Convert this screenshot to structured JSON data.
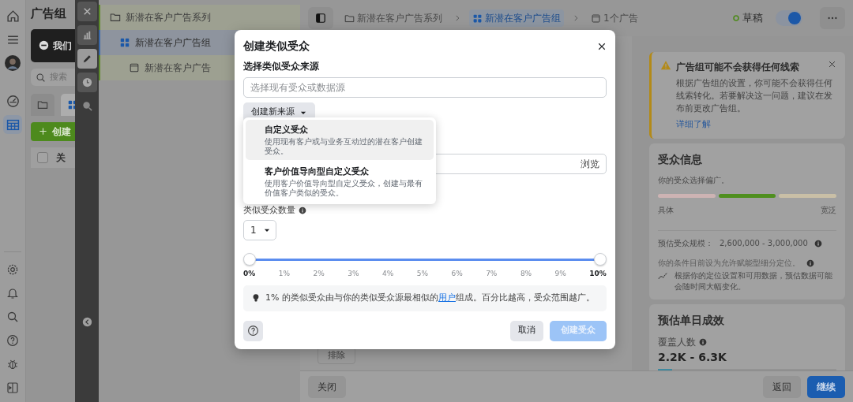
{
  "nav_rail": {
    "items": [
      {
        "kind": "home",
        "selected": false
      },
      {
        "kind": "menu",
        "selected": false
      },
      {
        "kind": "avatar",
        "selected": false
      },
      {
        "kind": "gauge",
        "selected": false
      },
      {
        "kind": "table",
        "selected": true
      }
    ],
    "bottom_items": [
      {
        "kind": "settings"
      },
      {
        "kind": "bell"
      },
      {
        "kind": "search"
      },
      {
        "kind": "help"
      },
      {
        "kind": "bug"
      },
      {
        "kind": "panel"
      }
    ]
  },
  "ad_panel": {
    "title": "广告组",
    "notice": "我们",
    "search": {
      "placeholder": "搜索"
    },
    "tabs": [
      {
        "kind": "campaign",
        "selected": false
      },
      {
        "kind": "adset",
        "selected": true
      }
    ],
    "create_button": "创建",
    "header": {
      "checked": false,
      "column_1": "关"
    }
  },
  "tool_strip": {
    "items": [
      {
        "kind": "close",
        "selected": false
      },
      {
        "kind": "chart",
        "selected": false
      },
      {
        "kind": "edit",
        "selected": true
      },
      {
        "kind": "history",
        "selected": false
      },
      {
        "kind": "inspect",
        "selected": false
      }
    ]
  },
  "tree": [
    {
      "kind": "campaign",
      "label": "新潜在客户广告系列",
      "selected": false,
      "children": [
        {
          "kind": "adset",
          "label": "新潜在客户广告组",
          "selected": true,
          "children": [
            {
              "kind": "ad",
              "label": "新潜在客户广告",
              "selected": false
            }
          ]
        }
      ]
    }
  ],
  "top_bar": {
    "breadcrumbs": [
      {
        "kind": "campaign",
        "label": "新潜在客户广告系列",
        "selected": false
      },
      {
        "kind": "adset",
        "label": "新潜在客户广告组",
        "selected": true
      },
      {
        "kind": "ad",
        "label": "1个广告",
        "selected": false
      }
    ],
    "status": "草稿",
    "toggle": {
      "on": true
    }
  },
  "middle": {
    "exclude_button": "排除"
  },
  "modal": {
    "title": "创建类似受众",
    "source_label": "选择类似受众来源",
    "source_field": {
      "placeholder": "选择现有受众或数据源"
    },
    "create_source_button": "创建新来源",
    "menu": [
      {
        "title": "自定义受众",
        "description": "使用现有客户或与业务互动过的潜在客户创建受众。",
        "selected": true
      },
      {
        "title": "客户价值导向型自定义受众",
        "description": "使用客户价值导向型自定义受众，创建与最有价值客户类似的受众。",
        "selected": false
      }
    ],
    "location_field": {
      "action": "浏览"
    },
    "count_label": "类似受众数量",
    "count_select": {
      "value": "1"
    },
    "slider": {
      "thumbs": [
        {
          "level": 0
        },
        {
          "level": 1
        }
      ],
      "ticks": [
        "0%",
        "1%",
        "2%",
        "3%",
        "4%",
        "5%",
        "6%",
        "7%",
        "8%",
        "9%",
        "10%"
      ]
    },
    "tip": {
      "before": "1% 的类似受众由与你的类似受众源最相似的",
      "link": "用户",
      "after": "组成。百分比越高，受众范围越广。"
    },
    "buttons": [
      {
        "label": "取消",
        "kind": "secondary",
        "disabled": false
      },
      {
        "label": "创建受众",
        "kind": "primary",
        "disabled": true
      }
    ]
  },
  "warning": {
    "title": "广告组可能不会获得任何线索",
    "body": "根据广告组的设置，你可能不会获得任何线索转化。若要解决这一问题，建议在发布前更改广告组。",
    "link": "详细了解"
  },
  "audience": {
    "title": "受众信息",
    "summary": "你的受众选择偏广。",
    "meter": [
      {
        "color": "#cdb3b3"
      },
      {
        "color": "#4f8f1f"
      },
      {
        "color": "#c9bfa6"
      }
    ],
    "left_label": "具体",
    "right_label": "宽泛",
    "size_label": "预估受众规模：",
    "size_value": "2,600,000 - 3,000,000",
    "targeting_note": "你的条件目前设为允许赋能型细分定位。",
    "variance_note": "根据你的定位设置和可用数据，预估数据可能会随时间大幅变化。"
  },
  "estimate": {
    "title": "预估单日成效",
    "metric_label": "覆盖人数",
    "metric_value": "2.2K - 6.3K",
    "level": 0.08
  },
  "bottom_bar": {
    "close": "关闭",
    "back": "返回",
    "continue": "继续"
  }
}
